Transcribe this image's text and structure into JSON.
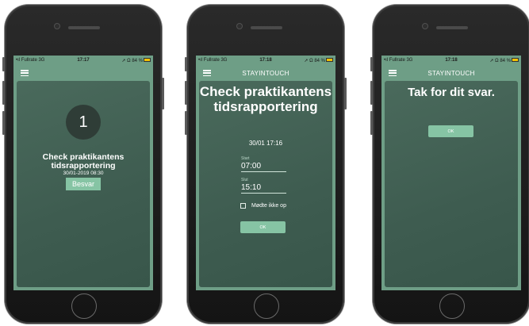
{
  "status_bar": {
    "carrier": "Fullrate 3G",
    "battery": "84 %"
  },
  "screens": [
    {
      "time": "17:17",
      "brand": "",
      "notification": {
        "count": "1",
        "title": "Check praktikantens tidsrapportering",
        "datetime": "30/01-2019 08:30",
        "button_label": "Besvar"
      }
    },
    {
      "time": "17:18",
      "brand": "STAYINTOUCH",
      "form": {
        "title": "Check praktikantens tidsrapportering",
        "datetime": "30/01 17:16",
        "start_label": "Start",
        "start_value": "07:00",
        "end_label": "Slut",
        "end_value": "15:10",
        "checkbox_label": "Mødte ikke op",
        "checkbox_checked": false,
        "ok_label": "OK"
      }
    },
    {
      "time": "17:18",
      "brand": "STAYINTOUCH",
      "confirmation": {
        "message": "Tak for dit svar.",
        "ok_label": "OK"
      }
    }
  ],
  "colors": {
    "screen_bg": "#6e9e86",
    "card_bg": "#445f53",
    "button": "#86c4a4",
    "battery": "#f2c200"
  }
}
